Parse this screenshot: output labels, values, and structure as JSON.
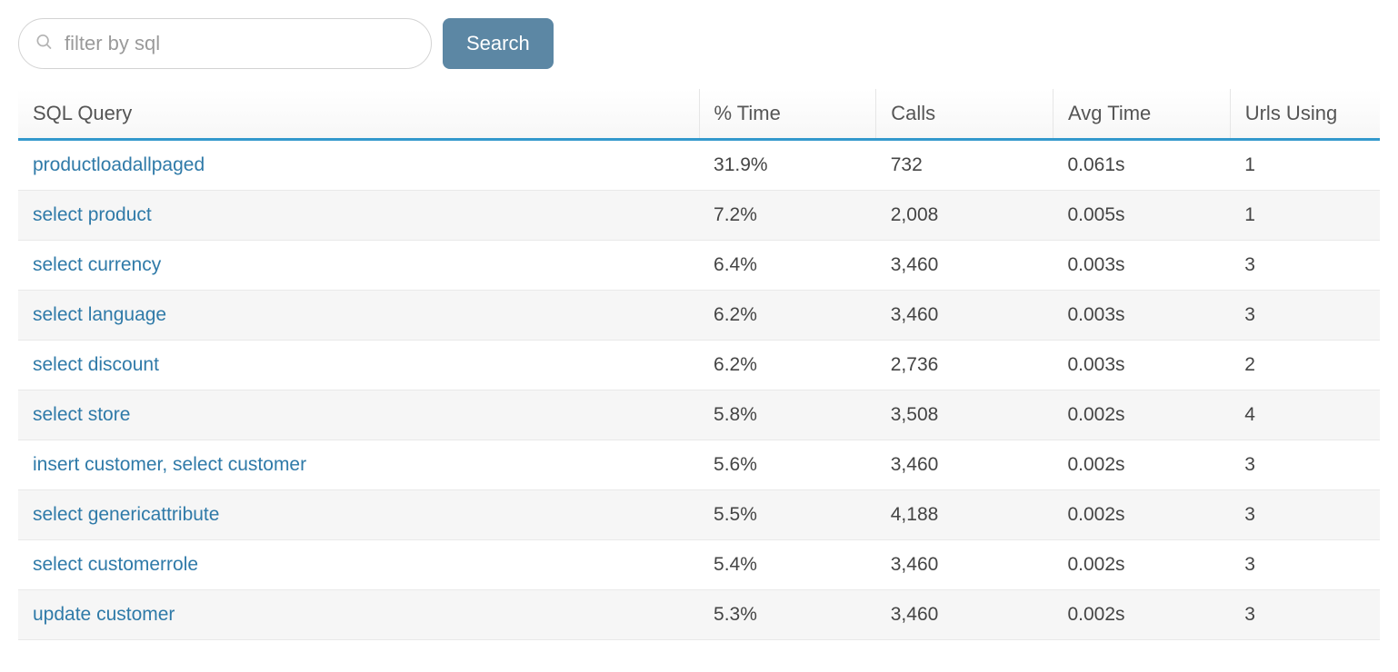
{
  "search": {
    "placeholder": "filter by sql",
    "button_label": "Search"
  },
  "table": {
    "headers": {
      "query": "SQL Query",
      "pct_time": "% Time",
      "calls": "Calls",
      "avg_time": "Avg Time",
      "urls_using": "Urls Using"
    },
    "rows": [
      {
        "query": "productloadallpaged",
        "pct_time": "31.9%",
        "calls": "732",
        "avg_time": "0.061s",
        "urls_using": "1"
      },
      {
        "query": "select product",
        "pct_time": "7.2%",
        "calls": "2,008",
        "avg_time": "0.005s",
        "urls_using": "1"
      },
      {
        "query": "select currency",
        "pct_time": "6.4%",
        "calls": "3,460",
        "avg_time": "0.003s",
        "urls_using": "3"
      },
      {
        "query": "select language",
        "pct_time": "6.2%",
        "calls": "3,460",
        "avg_time": "0.003s",
        "urls_using": "3"
      },
      {
        "query": "select discount",
        "pct_time": "6.2%",
        "calls": "2,736",
        "avg_time": "0.003s",
        "urls_using": "2"
      },
      {
        "query": "select store",
        "pct_time": "5.8%",
        "calls": "3,508",
        "avg_time": "0.002s",
        "urls_using": "4"
      },
      {
        "query": "insert customer, select customer",
        "pct_time": "5.6%",
        "calls": "3,460",
        "avg_time": "0.002s",
        "urls_using": "3"
      },
      {
        "query": "select genericattribute",
        "pct_time": "5.5%",
        "calls": "4,188",
        "avg_time": "0.002s",
        "urls_using": "3"
      },
      {
        "query": "select customerrole",
        "pct_time": "5.4%",
        "calls": "3,460",
        "avg_time": "0.002s",
        "urls_using": "3"
      },
      {
        "query": "update customer",
        "pct_time": "5.3%",
        "calls": "3,460",
        "avg_time": "0.002s",
        "urls_using": "3"
      }
    ]
  }
}
